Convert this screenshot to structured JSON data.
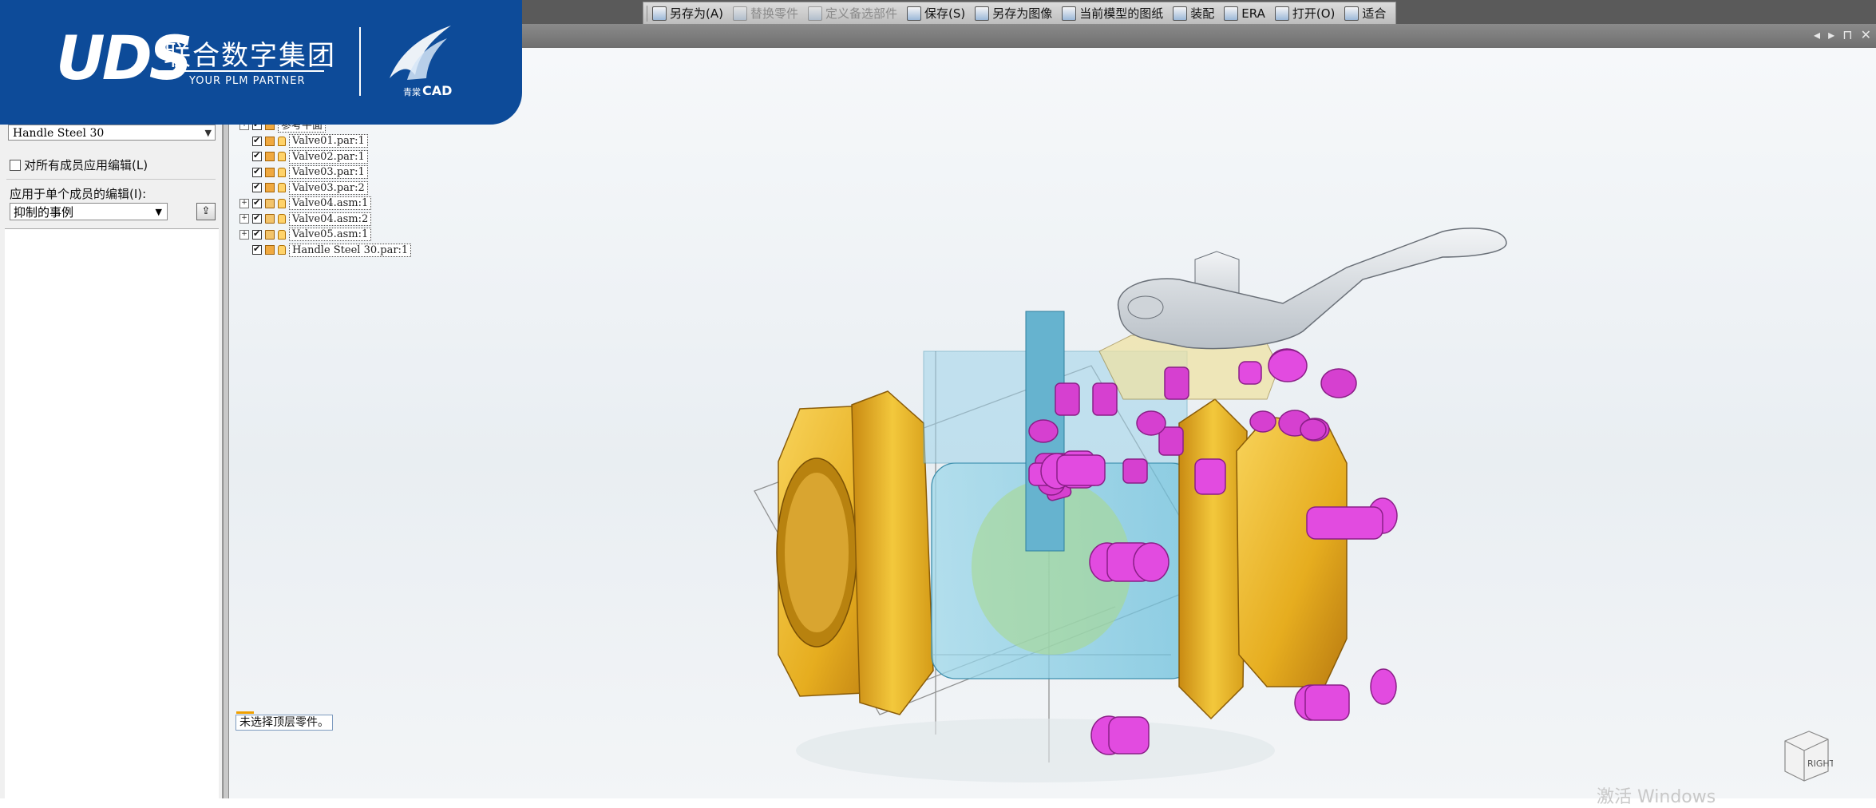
{
  "branding": {
    "uds": "UDS",
    "company_cn": "联合数字集团",
    "tagline": "YOUR PLM PARTNER",
    "product_prefix": "青棠",
    "product": "CAD"
  },
  "toolbar": {
    "items": [
      {
        "label": "另存为(A)",
        "icon": "save-as-icon",
        "enabled": true
      },
      {
        "label": "替换零件",
        "icon": "replace-part-icon",
        "enabled": false
      },
      {
        "label": "定义备选部件",
        "icon": "define-alternate-icon",
        "enabled": false
      },
      {
        "label": "保存(S)",
        "icon": "save-icon",
        "enabled": true
      },
      {
        "label": "另存为图像",
        "icon": "save-image-icon",
        "enabled": true
      },
      {
        "label": "当前模型的图纸",
        "icon": "drawing-icon",
        "enabled": true
      },
      {
        "label": "装配",
        "icon": "assembly-icon",
        "enabled": true
      },
      {
        "label": "ERA",
        "icon": "era-icon",
        "enabled": true
      },
      {
        "label": "打开(O)",
        "icon": "open-icon",
        "enabled": true
      },
      {
        "label": "适合",
        "icon": "fit-icon",
        "enabled": true
      }
    ]
  },
  "left_panel": {
    "selected_member": "Handle Steel 30",
    "apply_all_label": "对所有成员应用编辑(L)",
    "apply_single_label": "应用于单个成员的编辑(I):",
    "suppress_select": "抑制的事例"
  },
  "tree": {
    "items": [
      {
        "label": "参考平面",
        "expandable": true,
        "type": "ref"
      },
      {
        "label": "Valve01.par:1",
        "expandable": false,
        "type": "part"
      },
      {
        "label": "Valve02.par:1",
        "expandable": false,
        "type": "part"
      },
      {
        "label": "Valve03.par:1",
        "expandable": false,
        "type": "part"
      },
      {
        "label": "Valve03.par:2",
        "expandable": false,
        "type": "part"
      },
      {
        "label": "Valve04.asm:1",
        "expandable": true,
        "type": "asm"
      },
      {
        "label": "Valve04.asm:2",
        "expandable": true,
        "type": "asm"
      },
      {
        "label": "Valve05.asm:1",
        "expandable": true,
        "type": "asm"
      },
      {
        "label": "Handle Steel 30.par:1",
        "expandable": false,
        "type": "part"
      }
    ]
  },
  "status": {
    "message": "未选择顶层零件。"
  },
  "navcube": {
    "face": "RIGHT"
  },
  "watermark": "激活 Windows",
  "colors": {
    "brand_blue": "#0d4b99",
    "body_gold": "#e6b422",
    "bolt_magenta": "#d640d0",
    "transparent_cyan": "#8fd4e8"
  }
}
